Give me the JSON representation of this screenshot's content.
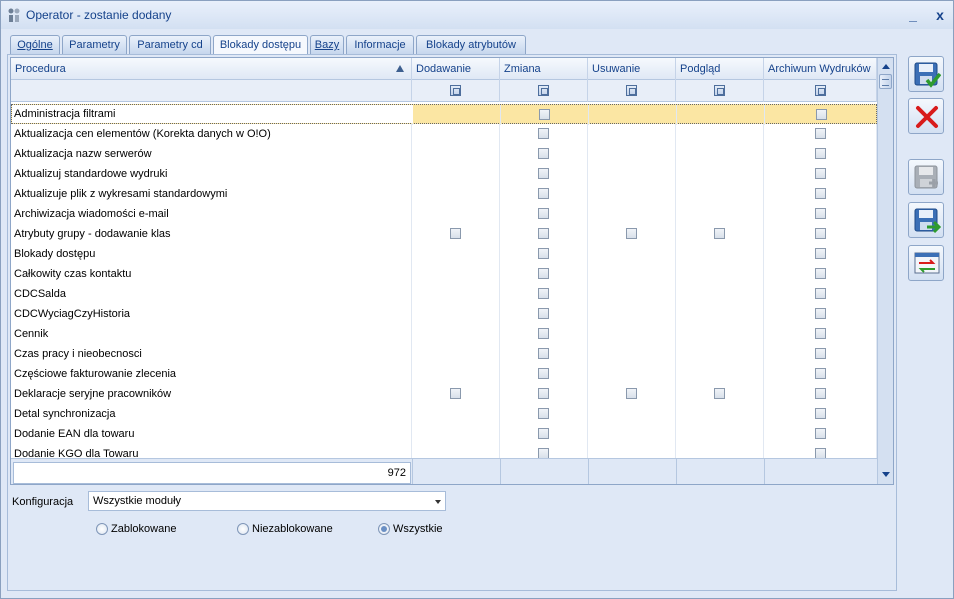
{
  "window": {
    "title": "Operator - zostanie dodany",
    "minimize": "_",
    "close": "x"
  },
  "tabs": [
    {
      "label": "Ogólne"
    },
    {
      "label": "Parametry"
    },
    {
      "label": "Parametry cd"
    },
    {
      "label": "Blokady dostępu"
    },
    {
      "label": "Bazy"
    },
    {
      "label": "Informacje"
    },
    {
      "label": "Blokady atrybutów"
    }
  ],
  "table": {
    "columns": [
      "Procedura",
      "Dodawanie",
      "Zmiana",
      "Usuwanie",
      "Podgląd",
      "Archiwum Wydruków"
    ],
    "rows": [
      {
        "name": "Administracja filtrami",
        "checks": [
          false,
          true,
          false,
          false,
          true
        ],
        "selected": true
      },
      {
        "name": "Aktualizacja cen elementów (Korekta danych w O!O)",
        "checks": [
          false,
          true,
          false,
          false,
          true
        ]
      },
      {
        "name": "Aktualizacja nazw serwerów",
        "checks": [
          false,
          true,
          false,
          false,
          true
        ]
      },
      {
        "name": "Aktualizuj standardowe wydruki",
        "checks": [
          false,
          true,
          false,
          false,
          true
        ]
      },
      {
        "name": "Aktualizuje plik z wykresami standardowymi",
        "checks": [
          false,
          true,
          false,
          false,
          true
        ]
      },
      {
        "name": "Archiwizacja wiadomości e-mail",
        "checks": [
          false,
          true,
          false,
          false,
          true
        ]
      },
      {
        "name": "Atrybuty grupy - dodawanie klas",
        "checks": [
          true,
          true,
          true,
          true,
          true
        ]
      },
      {
        "name": "Blokady dostępu",
        "checks": [
          false,
          true,
          false,
          false,
          true
        ]
      },
      {
        "name": "Całkowity czas kontaktu",
        "checks": [
          false,
          true,
          false,
          false,
          true
        ]
      },
      {
        "name": "CDCSalda",
        "checks": [
          false,
          true,
          false,
          false,
          true
        ]
      },
      {
        "name": "CDCWyciagCzyHistoria",
        "checks": [
          false,
          true,
          false,
          false,
          true
        ]
      },
      {
        "name": "Cennik",
        "checks": [
          false,
          true,
          false,
          false,
          true
        ]
      },
      {
        "name": "Czas pracy i nieobecnosci",
        "checks": [
          false,
          true,
          false,
          false,
          true
        ]
      },
      {
        "name": "Częściowe fakturowanie zlecenia",
        "checks": [
          false,
          true,
          false,
          false,
          true
        ]
      },
      {
        "name": "Deklaracje seryjne pracowników",
        "checks": [
          true,
          true,
          true,
          true,
          true
        ]
      },
      {
        "name": "Detal synchronizacja",
        "checks": [
          false,
          true,
          false,
          false,
          true
        ]
      },
      {
        "name": "Dodanie EAN dla towaru",
        "checks": [
          false,
          true,
          false,
          false,
          true
        ]
      },
      {
        "name": "Dodanie KGO dla Towaru",
        "checks": [
          false,
          true,
          false,
          false,
          true
        ]
      }
    ],
    "count": "972"
  },
  "config": {
    "label": "Konfiguracja",
    "selected": "Wszystkie moduły",
    "radios": [
      {
        "label": "Zablokowane",
        "checked": false
      },
      {
        "label": "Niezablokowane",
        "checked": false
      },
      {
        "label": "Wszystkie",
        "checked": true
      }
    ]
  },
  "icons": {
    "app": "operator-icon",
    "save": "save-icon",
    "cancel": "cancel-icon",
    "save_disabled": "save-disabled-icon",
    "save_next": "save-and-next-icon",
    "transfer": "transfer-icon"
  },
  "colors": {
    "selected_row": "#fbe6a3",
    "title_text": "#15428b",
    "cancel_red": "#d81b1b"
  }
}
